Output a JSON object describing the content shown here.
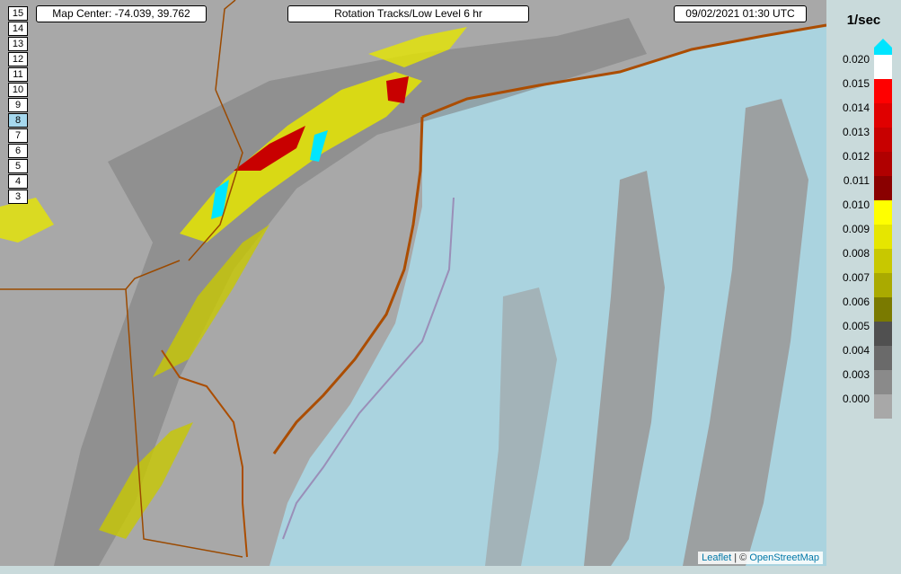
{
  "map": {
    "zoom_levels": [
      "15",
      "14",
      "13",
      "12",
      "11",
      "10",
      "9",
      "8",
      "7",
      "6",
      "5",
      "4",
      "3"
    ],
    "active_zoom": "8",
    "center_label": "Map Center: -74.039, 39.762",
    "product_label": "Rotation Tracks/Low Level 6 hr",
    "timestamp_label": "09/02/2021   01:30 UTC",
    "attribution": {
      "leaflet": "Leaflet",
      "separator": " | © ",
      "osm": "OpenStreetMap"
    },
    "colors": {
      "land": "#a8a8a8",
      "ocean": "#aad3df",
      "border": "#9b4a00",
      "shoreline": "#ab4d00"
    }
  },
  "legend": {
    "unit": "1/sec",
    "ticks": [
      "0.020",
      "0.015",
      "0.014",
      "0.013",
      "0.012",
      "0.011",
      "0.010",
      "0.009",
      "0.008",
      "0.007",
      "0.006",
      "0.005",
      "0.004",
      "0.003",
      "0.000"
    ],
    "colors": [
      "#ffffff",
      "#ff0000",
      "#e00000",
      "#c80000",
      "#b00000",
      "#8a0000",
      "#ffff00",
      "#e6e600",
      "#c8c800",
      "#aaaa00",
      "#7a7a00",
      "#505050",
      "#6a6a6a",
      "#8a8a8a",
      "#a8a8a8"
    ],
    "top_color": "#00e5ff"
  }
}
